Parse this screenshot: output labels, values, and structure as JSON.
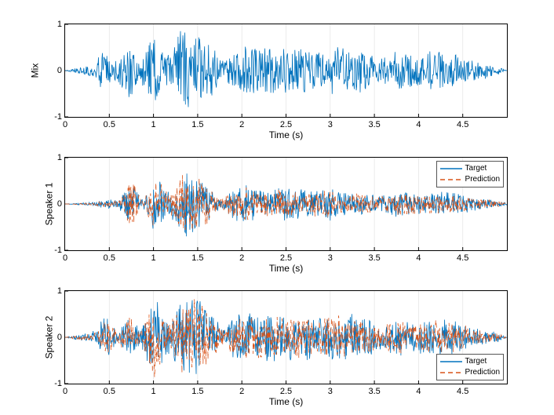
{
  "chart_data": [
    {
      "type": "line",
      "title": "",
      "ylabel": "Mix",
      "xlabel": "Time (s)",
      "xlim": [
        0,
        5
      ],
      "ylim": [
        -1,
        1
      ],
      "xticks": [
        0,
        0.5,
        1,
        1.5,
        2,
        2.5,
        3,
        3.5,
        4,
        4.5
      ],
      "yticks": [
        -1,
        0,
        1
      ],
      "series": [
        {
          "name": "Mix",
          "color": "#0072BD",
          "style": "solid",
          "envelope_peaks": [
            [
              0,
              0
            ],
            [
              0.35,
              0.18
            ],
            [
              0.42,
              0.62
            ],
            [
              0.55,
              0.18
            ],
            [
              0.72,
              0.78
            ],
            [
              0.84,
              0.2
            ],
            [
              1.0,
              0.97
            ],
            [
              1.18,
              0.3
            ],
            [
              1.3,
              0.95
            ],
            [
              1.55,
              0.88
            ],
            [
              1.78,
              0.22
            ],
            [
              1.95,
              0.55
            ],
            [
              2.2,
              0.62
            ],
            [
              2.45,
              0.5
            ],
            [
              2.68,
              0.58
            ],
            [
              2.92,
              0.45
            ],
            [
              3.1,
              0.6
            ],
            [
              3.32,
              0.55
            ],
            [
              3.55,
              0.32
            ],
            [
              3.78,
              0.45
            ],
            [
              4.0,
              0.38
            ],
            [
              4.25,
              0.48
            ],
            [
              4.48,
              0.35
            ],
            [
              4.7,
              0.22
            ],
            [
              4.9,
              0.1
            ],
            [
              5.0,
              0
            ]
          ]
        }
      ]
    },
    {
      "type": "line",
      "title": "",
      "ylabel": "Speaker 1",
      "xlabel": "Time (s)",
      "xlim": [
        0,
        5
      ],
      "ylim": [
        -1,
        1
      ],
      "xticks": [
        0,
        0.5,
        1,
        1.5,
        2,
        2.5,
        3,
        3.5,
        4,
        4.5
      ],
      "yticks": [
        -1,
        0,
        1
      ],
      "legend": {
        "entries": [
          "Target",
          "Prediction"
        ],
        "position": "upper-right"
      },
      "series": [
        {
          "name": "Target",
          "color": "#0072BD",
          "style": "solid",
          "envelope_peaks": [
            [
              0,
              0
            ],
            [
              0.35,
              0.05
            ],
            [
              0.45,
              0.12
            ],
            [
              0.6,
              0.08
            ],
            [
              0.75,
              0.62
            ],
            [
              0.88,
              0.1
            ],
            [
              1.02,
              0.72
            ],
            [
              1.18,
              0.25
            ],
            [
              1.3,
              0.78
            ],
            [
              1.52,
              0.7
            ],
            [
              1.75,
              0.12
            ],
            [
              1.98,
              0.48
            ],
            [
              2.25,
              0.35
            ],
            [
              2.5,
              0.4
            ],
            [
              2.75,
              0.3
            ],
            [
              2.98,
              0.38
            ],
            [
              3.15,
              0.3
            ],
            [
              3.35,
              0.25
            ],
            [
              3.55,
              0.2
            ],
            [
              3.8,
              0.32
            ],
            [
              4.05,
              0.25
            ],
            [
              4.3,
              0.28
            ],
            [
              4.55,
              0.2
            ],
            [
              4.8,
              0.12
            ],
            [
              5.0,
              0.02
            ]
          ]
        },
        {
          "name": "Prediction",
          "color": "#D95319",
          "style": "dashed",
          "envelope_peaks": [
            [
              0,
              0
            ],
            [
              0.35,
              0.04
            ],
            [
              0.45,
              0.1
            ],
            [
              0.6,
              0.06
            ],
            [
              0.75,
              0.58
            ],
            [
              0.88,
              0.08
            ],
            [
              1.02,
              0.68
            ],
            [
              1.18,
              0.22
            ],
            [
              1.3,
              0.74
            ],
            [
              1.52,
              0.66
            ],
            [
              1.75,
              0.1
            ],
            [
              1.98,
              0.44
            ],
            [
              2.25,
              0.3
            ],
            [
              2.5,
              0.35
            ],
            [
              2.75,
              0.26
            ],
            [
              2.98,
              0.32
            ],
            [
              3.15,
              0.26
            ],
            [
              3.35,
              0.22
            ],
            [
              3.55,
              0.17
            ],
            [
              3.8,
              0.28
            ],
            [
              4.05,
              0.22
            ],
            [
              4.3,
              0.24
            ],
            [
              4.55,
              0.17
            ],
            [
              4.8,
              0.1
            ],
            [
              5.0,
              0.02
            ]
          ]
        }
      ]
    },
    {
      "type": "line",
      "title": "",
      "ylabel": "Speaker 2",
      "xlabel": "Time (s)",
      "xlim": [
        0,
        5
      ],
      "ylim": [
        -1,
        1
      ],
      "xticks": [
        0,
        0.5,
        1,
        1.5,
        2,
        2.5,
        3,
        3.5,
        4,
        4.5
      ],
      "yticks": [
        -1,
        0,
        1
      ],
      "legend": {
        "entries": [
          "Target",
          "Prediction"
        ],
        "position": "lower-right"
      },
      "series": [
        {
          "name": "Target",
          "color": "#0072BD",
          "style": "solid",
          "envelope_peaks": [
            [
              0,
              0
            ],
            [
              0.35,
              0.15
            ],
            [
              0.45,
              0.55
            ],
            [
              0.6,
              0.12
            ],
            [
              0.72,
              0.55
            ],
            [
              0.85,
              0.15
            ],
            [
              1.0,
              0.95
            ],
            [
              1.18,
              0.35
            ],
            [
              1.3,
              0.9
            ],
            [
              1.55,
              0.85
            ],
            [
              1.78,
              0.2
            ],
            [
              1.95,
              0.55
            ],
            [
              2.2,
              0.6
            ],
            [
              2.45,
              0.5
            ],
            [
              2.68,
              0.55
            ],
            [
              2.92,
              0.45
            ],
            [
              3.1,
              0.58
            ],
            [
              3.32,
              0.52
            ],
            [
              3.55,
              0.3
            ],
            [
              3.78,
              0.42
            ],
            [
              4.0,
              0.35
            ],
            [
              4.25,
              0.45
            ],
            [
              4.48,
              0.32
            ],
            [
              4.7,
              0.2
            ],
            [
              4.9,
              0.1
            ],
            [
              5.0,
              0
            ]
          ]
        },
        {
          "name": "Prediction",
          "color": "#D95319",
          "style": "dashed",
          "envelope_peaks": [
            [
              0,
              0
            ],
            [
              0.35,
              0.13
            ],
            [
              0.45,
              0.52
            ],
            [
              0.6,
              0.1
            ],
            [
              0.72,
              0.52
            ],
            [
              0.85,
              0.13
            ],
            [
              1.0,
              0.92
            ],
            [
              1.18,
              0.32
            ],
            [
              1.3,
              0.87
            ],
            [
              1.55,
              0.82
            ],
            [
              1.78,
              0.18
            ],
            [
              1.95,
              0.5
            ],
            [
              2.2,
              0.56
            ],
            [
              2.45,
              0.46
            ],
            [
              2.68,
              0.51
            ],
            [
              2.92,
              0.42
            ],
            [
              3.1,
              0.54
            ],
            [
              3.32,
              0.48
            ],
            [
              3.55,
              0.27
            ],
            [
              3.78,
              0.38
            ],
            [
              4.0,
              0.32
            ],
            [
              4.25,
              0.42
            ],
            [
              4.48,
              0.29
            ],
            [
              4.7,
              0.18
            ],
            [
              4.9,
              0.09
            ],
            [
              5.0,
              0
            ]
          ]
        }
      ]
    }
  ]
}
